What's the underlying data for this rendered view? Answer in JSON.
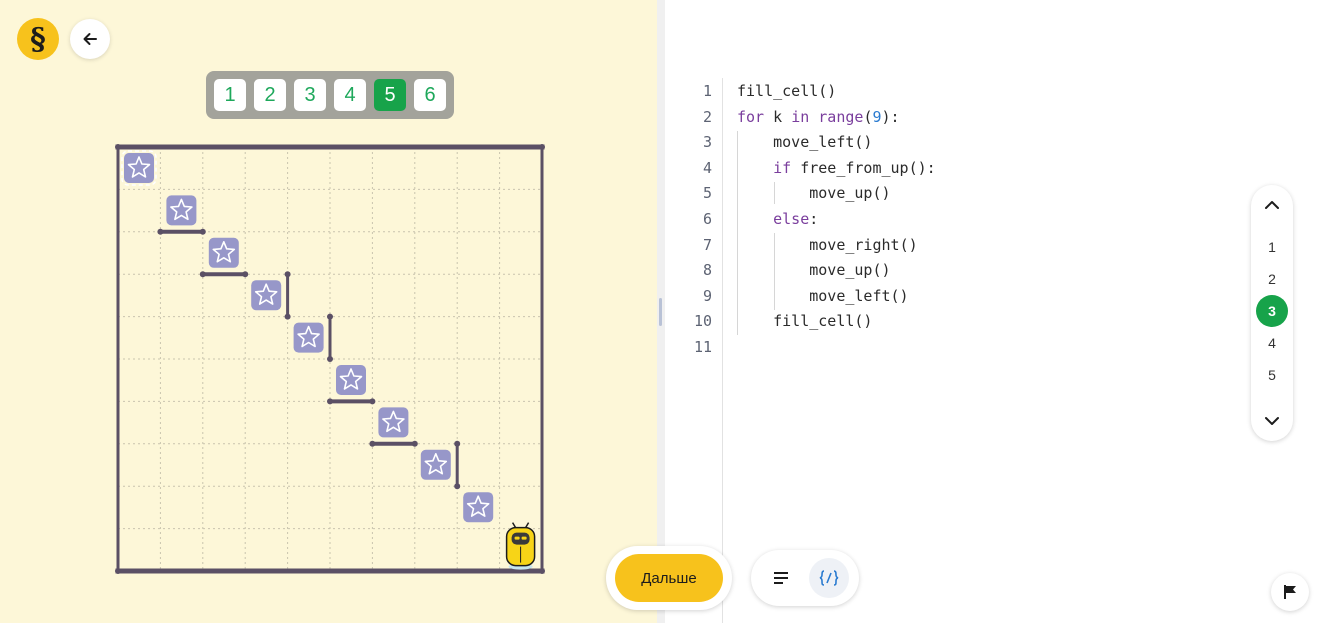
{
  "header": {
    "logo_text": "§",
    "back_icon": "arrow-left-icon"
  },
  "levels": [
    "1",
    "2",
    "3",
    "4",
    "5",
    "6"
  ],
  "active_level": "5",
  "board": {
    "cols": 10,
    "rows": 10,
    "colors": {
      "background": "#fdf7d8",
      "wall": "#5b5065",
      "star_tile": "#9797c9",
      "robot": "#f7d417"
    },
    "stars": [
      [
        0,
        0
      ],
      [
        1,
        1
      ],
      [
        2,
        2
      ],
      [
        3,
        3
      ],
      [
        4,
        4
      ],
      [
        5,
        5
      ],
      [
        6,
        6
      ],
      [
        7,
        7
      ],
      [
        8,
        8
      ]
    ],
    "target_marked": [
      0,
      0
    ],
    "robot": [
      9,
      9
    ],
    "walls_horizontal": [
      [
        1,
        2
      ],
      [
        2,
        3
      ],
      [
        5,
        6
      ],
      [
        6,
        7
      ]
    ],
    "walls_vertical": [
      [
        4,
        3
      ],
      [
        5,
        4
      ],
      [
        8,
        7
      ]
    ]
  },
  "editor": {
    "lines": [
      {
        "n": "1",
        "code": "fill_cell()"
      },
      {
        "n": "2",
        "code": "for k in range(9):"
      },
      {
        "n": "3",
        "code": "    move_left()"
      },
      {
        "n": "4",
        "code": "    if free_from_up():"
      },
      {
        "n": "5",
        "code": "        move_up()"
      },
      {
        "n": "6",
        "code": "    else:"
      },
      {
        "n": "7",
        "code": "        move_right()"
      },
      {
        "n": "8",
        "code": "        move_up()"
      },
      {
        "n": "9",
        "code": "        move_left()"
      },
      {
        "n": "10",
        "code": "    fill_cell()"
      },
      {
        "n": "11",
        "code": ""
      }
    ]
  },
  "pager": {
    "items": [
      "1",
      "2",
      "3",
      "4",
      "5"
    ],
    "active": "3"
  },
  "footer": {
    "next_label": "Дальше",
    "tool_text_icon": "align-left-icon",
    "tool_code_icon": "code-braces-icon",
    "flag_icon": "flag-icon"
  }
}
